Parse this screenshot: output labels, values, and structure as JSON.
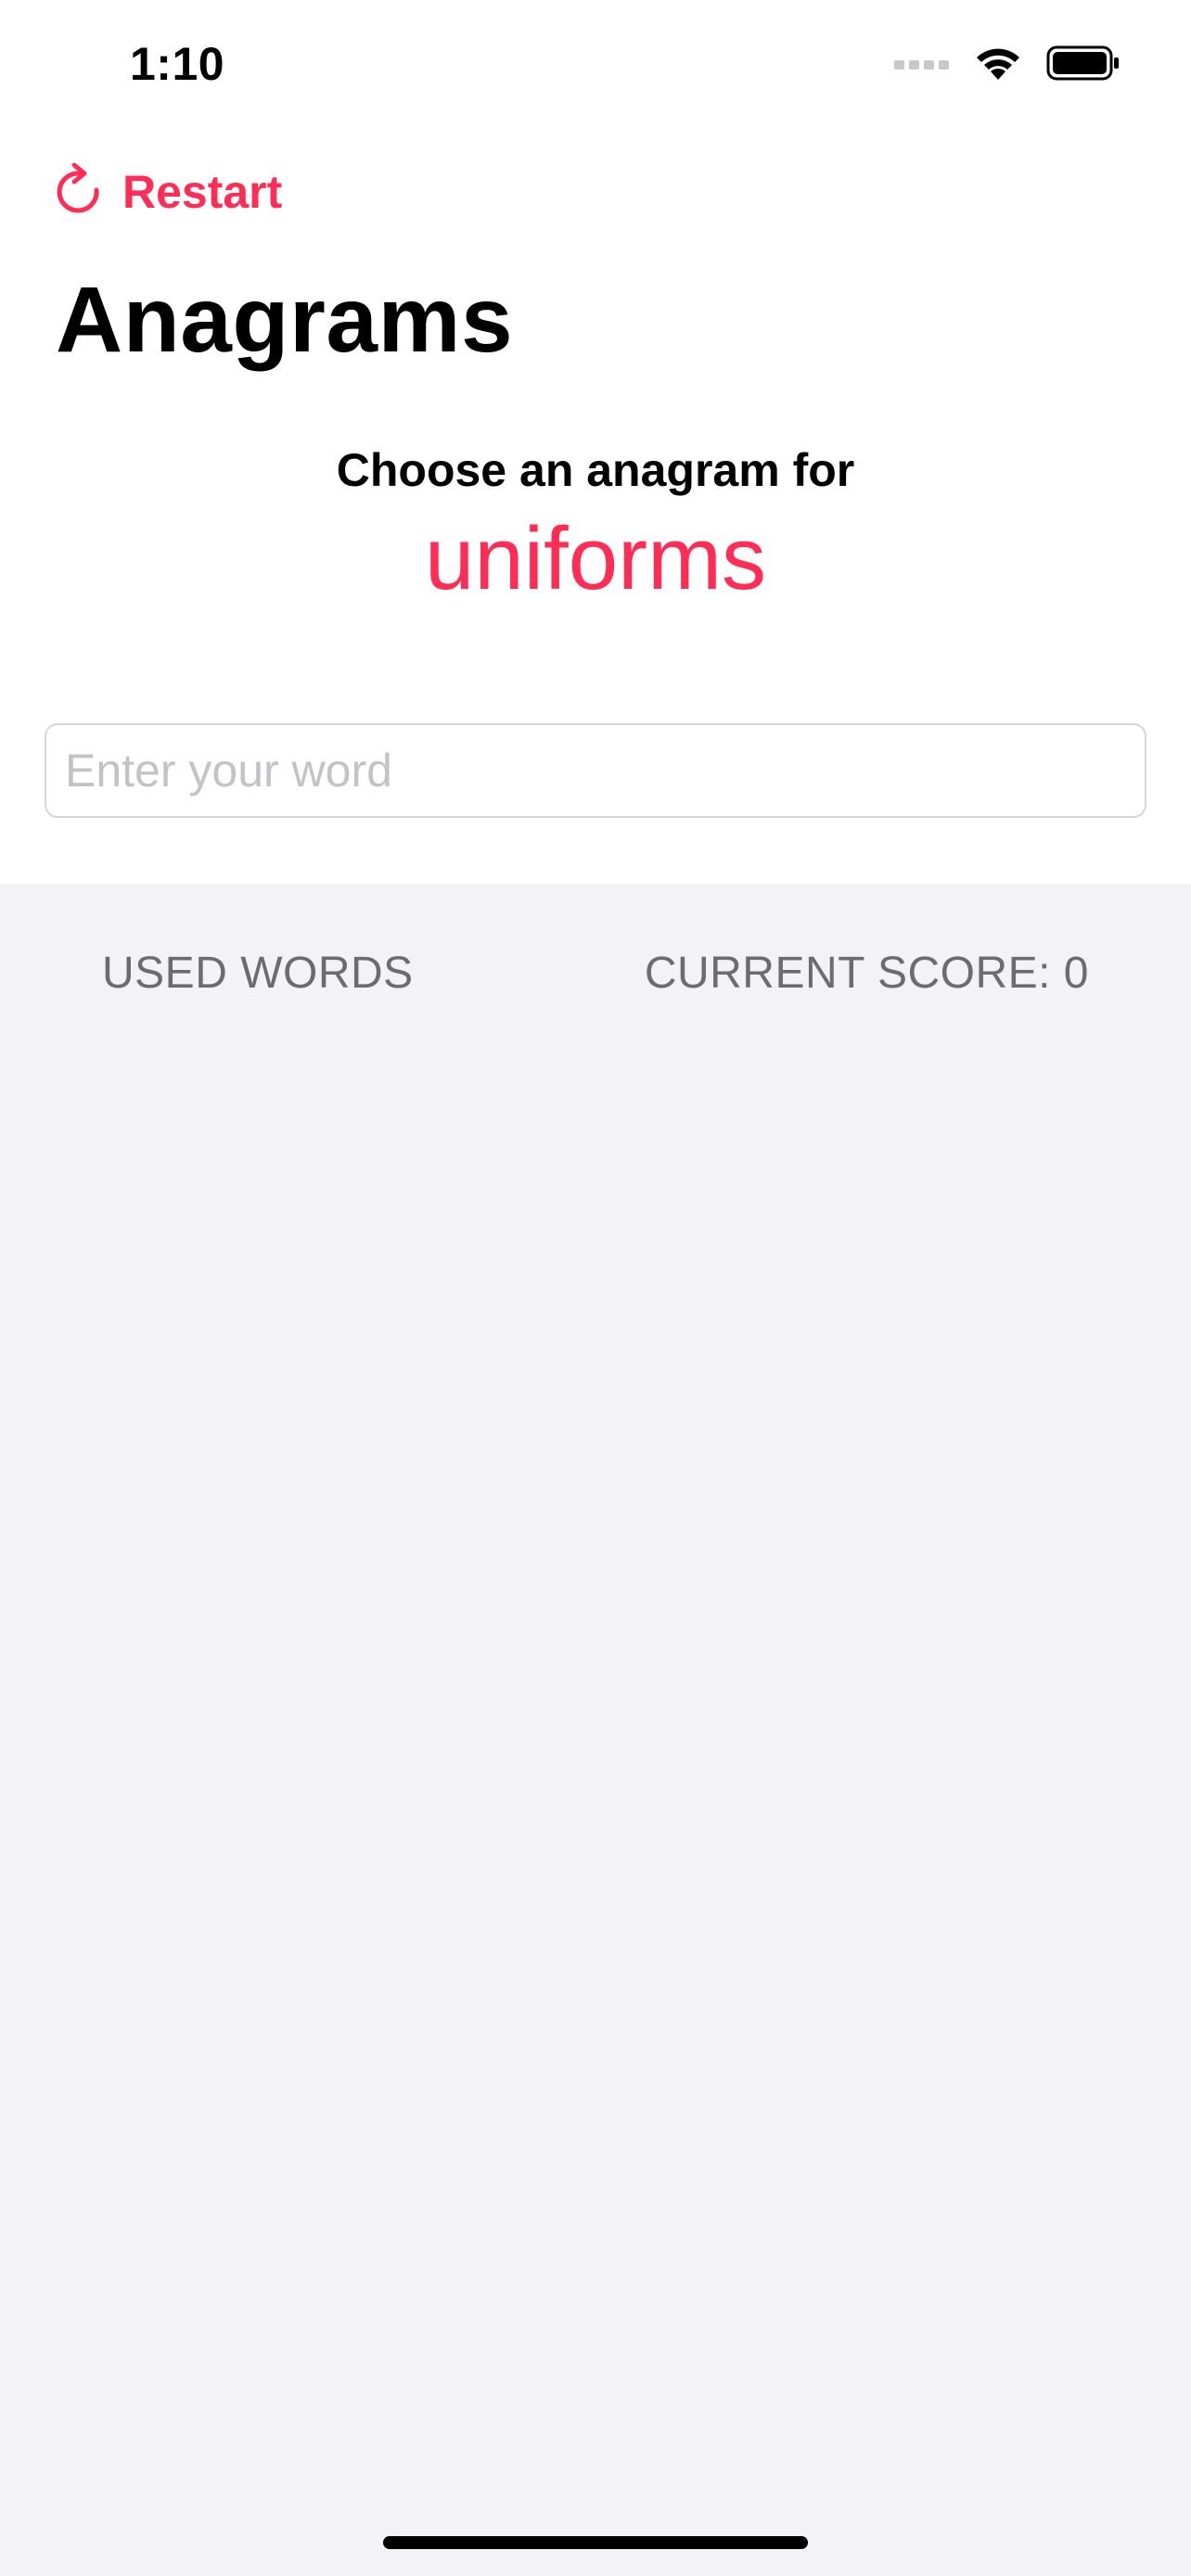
{
  "status_bar": {
    "time": "1:10",
    "icons": [
      "cellular-signal-icon",
      "wifi-icon",
      "battery-icon"
    ]
  },
  "toolbar": {
    "restart_icon": "arrow-clockwise-icon",
    "restart_label": "Restart"
  },
  "header": {
    "title": "Anagrams"
  },
  "prompt": {
    "label": "Choose an anagram for",
    "root_word": "uniforms"
  },
  "input": {
    "value": "",
    "placeholder": "Enter your word"
  },
  "list": {
    "used_words_header": "USED WORDS",
    "score_header": "CURRENT SCORE: 0"
  },
  "colors": {
    "accent": "#ff2d55",
    "background_grouped": "#f2f2f7",
    "secondary_text": "#6c6c70"
  }
}
